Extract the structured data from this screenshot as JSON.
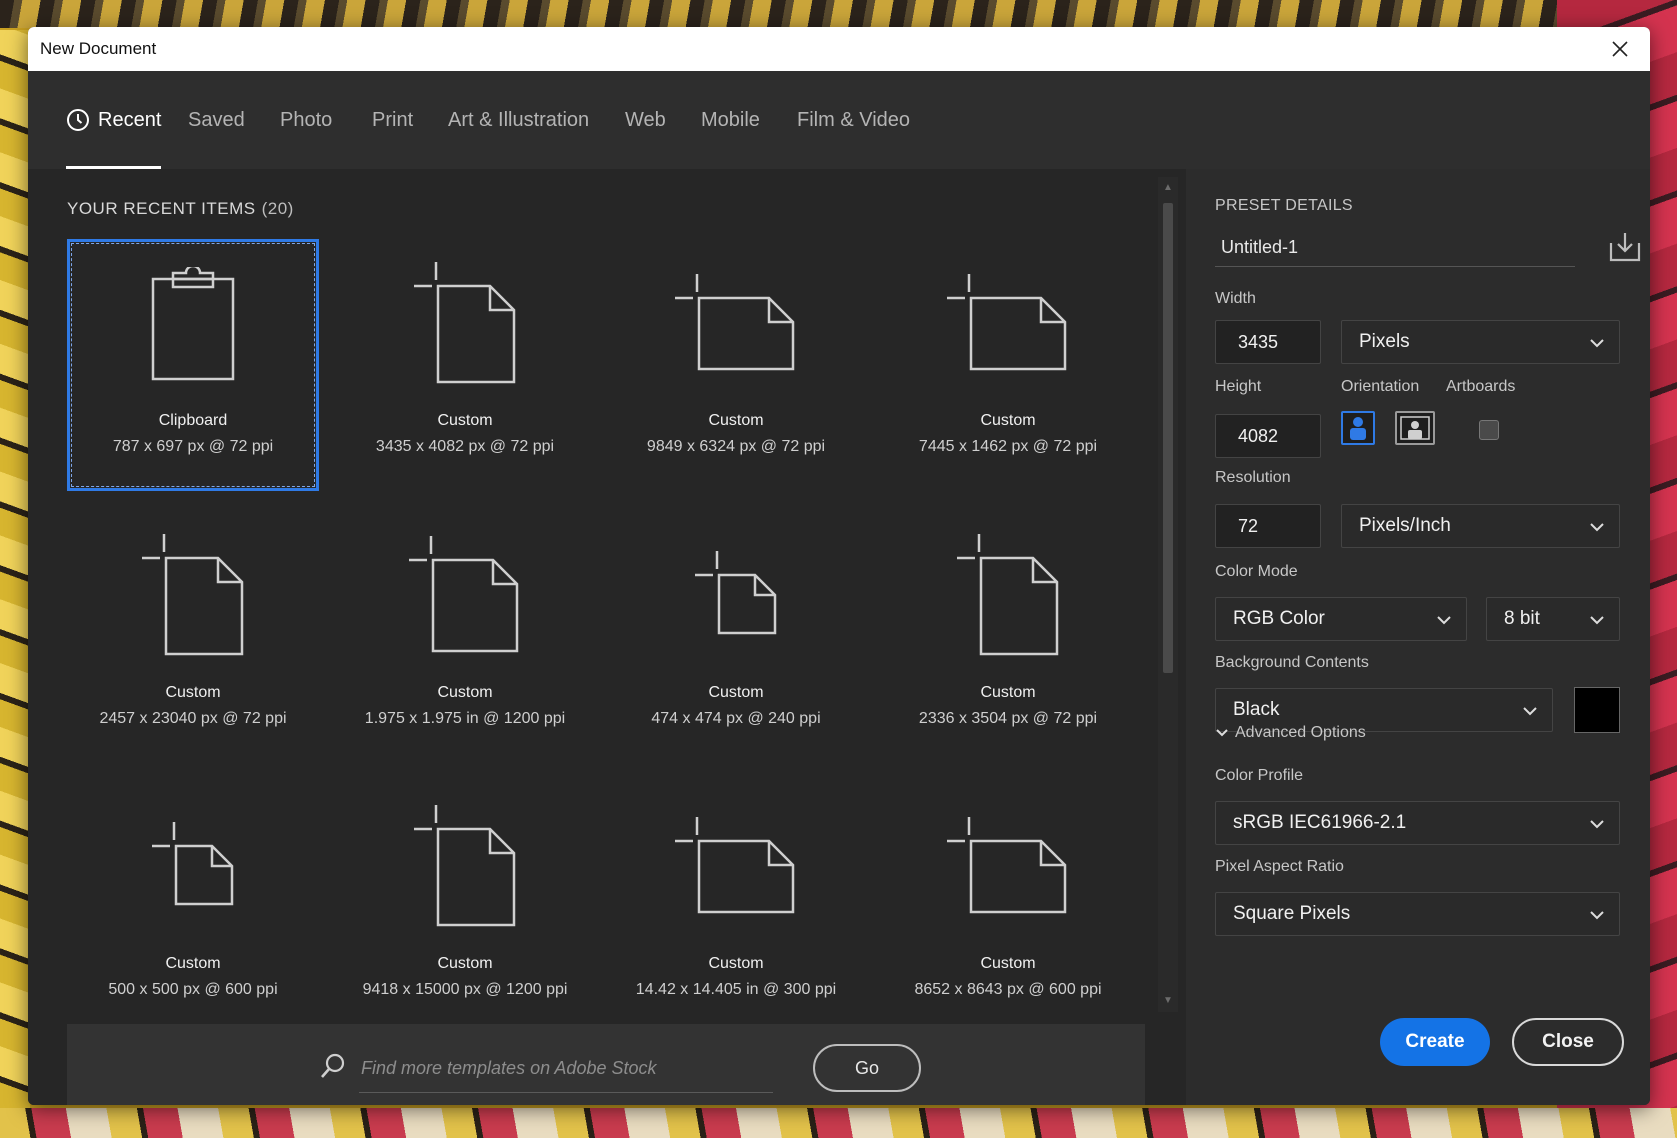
{
  "window": {
    "title": "New Document"
  },
  "tabs": [
    {
      "label": "Recent",
      "active": true,
      "icon": "clock-icon"
    },
    {
      "label": "Saved"
    },
    {
      "label": "Photo"
    },
    {
      "label": "Print"
    },
    {
      "label": "Art & Illustration"
    },
    {
      "label": "Web"
    },
    {
      "label": "Mobile"
    },
    {
      "label": "Film & Video"
    }
  ],
  "recent": {
    "heading": "YOUR RECENT ITEMS",
    "count": "(20)",
    "items": [
      {
        "name": "Clipboard",
        "dims": "787 x 697 px @ 72 ppi",
        "icon": "clipboard-icon",
        "selected": true
      },
      {
        "name": "Custom",
        "dims": "3435 x 4082 px @ 72 ppi",
        "icon": "document-portrait-icon"
      },
      {
        "name": "Custom",
        "dims": "9849 x 6324 px @ 72 ppi",
        "icon": "document-landscape-icon"
      },
      {
        "name": "Custom",
        "dims": "7445 x 1462 px @ 72 ppi",
        "icon": "document-landscape-icon"
      },
      {
        "name": "Custom",
        "dims": "2457 x 23040 px @ 72 ppi",
        "icon": "document-portrait-icon"
      },
      {
        "name": "Custom",
        "dims": "1.975 x 1.975 in @ 1200 ppi",
        "icon": "document-square-icon"
      },
      {
        "name": "Custom",
        "dims": "474 x 474 px @ 240 ppi",
        "icon": "document-small-icon"
      },
      {
        "name": "Custom",
        "dims": "2336 x 3504 px @ 72 ppi",
        "icon": "document-portrait-icon"
      },
      {
        "name": "Custom",
        "dims": "500 x 500 px @ 600 ppi",
        "icon": "document-small-icon"
      },
      {
        "name": "Custom",
        "dims": "9418 x 15000 px @ 1200 ppi",
        "icon": "document-portrait-icon"
      },
      {
        "name": "Custom",
        "dims": "14.42 x 14.405 in @ 300 ppi",
        "icon": "document-landscape-icon"
      },
      {
        "name": "Custom",
        "dims": "8652 x 8643 px @ 600 ppi",
        "icon": "document-landscape-icon"
      }
    ]
  },
  "search": {
    "placeholder": "Find more templates on Adobe Stock",
    "go_label": "Go"
  },
  "preset": {
    "heading": "PRESET DETAILS",
    "name": "Untitled-1",
    "width_label": "Width",
    "width_value": "3435",
    "width_unit": "Pixels",
    "height_label": "Height",
    "height_value": "4082",
    "orientation_label": "Orientation",
    "artboards_label": "Artboards",
    "resolution_label": "Resolution",
    "resolution_value": "72",
    "resolution_unit": "Pixels/Inch",
    "color_mode_label": "Color Mode",
    "color_mode": "RGB Color",
    "bit_depth": "8 bit",
    "background_label": "Background Contents",
    "background_value": "Black",
    "background_swatch": "#000000",
    "advanced_label": "Advanced Options",
    "color_profile_label": "Color Profile",
    "color_profile": "sRGB IEC61966-2.1",
    "pixel_aspect_label": "Pixel Aspect Ratio",
    "pixel_aspect": "Square Pixels"
  },
  "actions": {
    "create_label": "Create",
    "close_label": "Close"
  },
  "colors": {
    "accent": "#1473e6",
    "selection": "#2f7ae5",
    "panel": "#262626"
  }
}
